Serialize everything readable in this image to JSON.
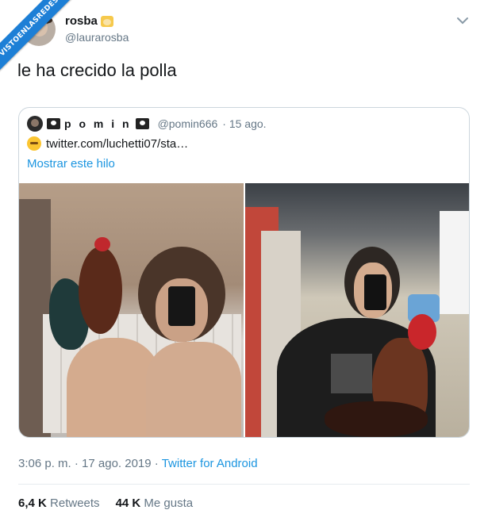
{
  "watermark": "VISTOENLASREDES",
  "author": {
    "name": "rosba",
    "handle": "@laurarosba",
    "emoji_icon": "crown-emoji-icon"
  },
  "tweet": {
    "text": "le ha crecido la polla"
  },
  "quoted": {
    "name": "p o m i n",
    "handle": "@pomin666",
    "date": "· 15 ago.",
    "link": "twitter.com/luchetti07/sta…",
    "show_thread": "Mostrar este hilo"
  },
  "meta": {
    "time": "3:06 p. m. · 17 ago. 2019 ·",
    "via": "Twitter for Android"
  },
  "stats": {
    "retweets_count": "6,4 K",
    "retweets_label": "Retweets",
    "likes_count": "44 K",
    "likes_label": "Me gusta"
  },
  "colors": {
    "link": "#1b95e0",
    "muted": "#657786",
    "ribbon": "#1d7fd6"
  }
}
